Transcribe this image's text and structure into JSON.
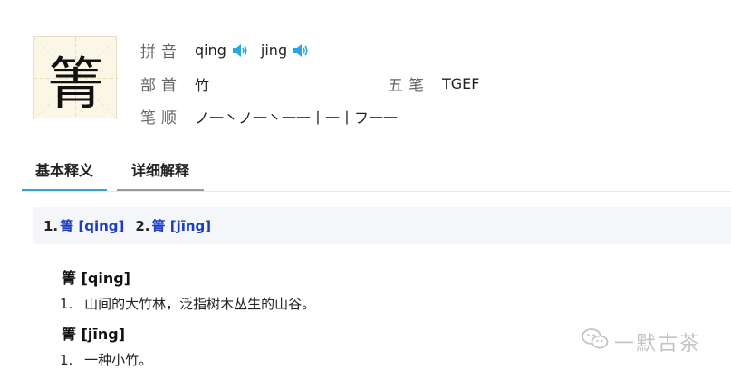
{
  "character": "箐",
  "pinyin": {
    "label": "拼音",
    "readings": [
      {
        "text": "qing",
        "speaker_icon": "speaker-icon"
      },
      {
        "text": "jing",
        "speaker_icon": "speaker-icon"
      }
    ]
  },
  "radical": {
    "label": "部首",
    "value": "竹"
  },
  "wubi": {
    "label": "五笔",
    "value": "TGEF"
  },
  "strokes": {
    "label": "笔顺",
    "value": "ノ一丶ノ一丶一一丨一丨フ一一"
  },
  "tabs": [
    {
      "label": "基本释义",
      "active": true
    },
    {
      "label": "详细解释",
      "active": false
    }
  ],
  "readings_bar": [
    {
      "num": "1.",
      "link": "箐 [qing]"
    },
    {
      "num": "2.",
      "link": "箐 [jīng]"
    }
  ],
  "entries": [
    {
      "head": "箐 [qing]",
      "def_num": "1.",
      "def": "山间的大竹林，泛指树木丛生的山谷。"
    },
    {
      "head": "箐 [jīng]",
      "def_num": "1.",
      "def": "一种小竹。"
    }
  ],
  "watermark": {
    "text": "一默古茶",
    "icon": "wechat-icon"
  },
  "colors": {
    "accent": "#3aa0d8",
    "link": "#1a3dc1",
    "char_bg": "#fbf7e6",
    "bar_bg": "#f4f6f9"
  }
}
